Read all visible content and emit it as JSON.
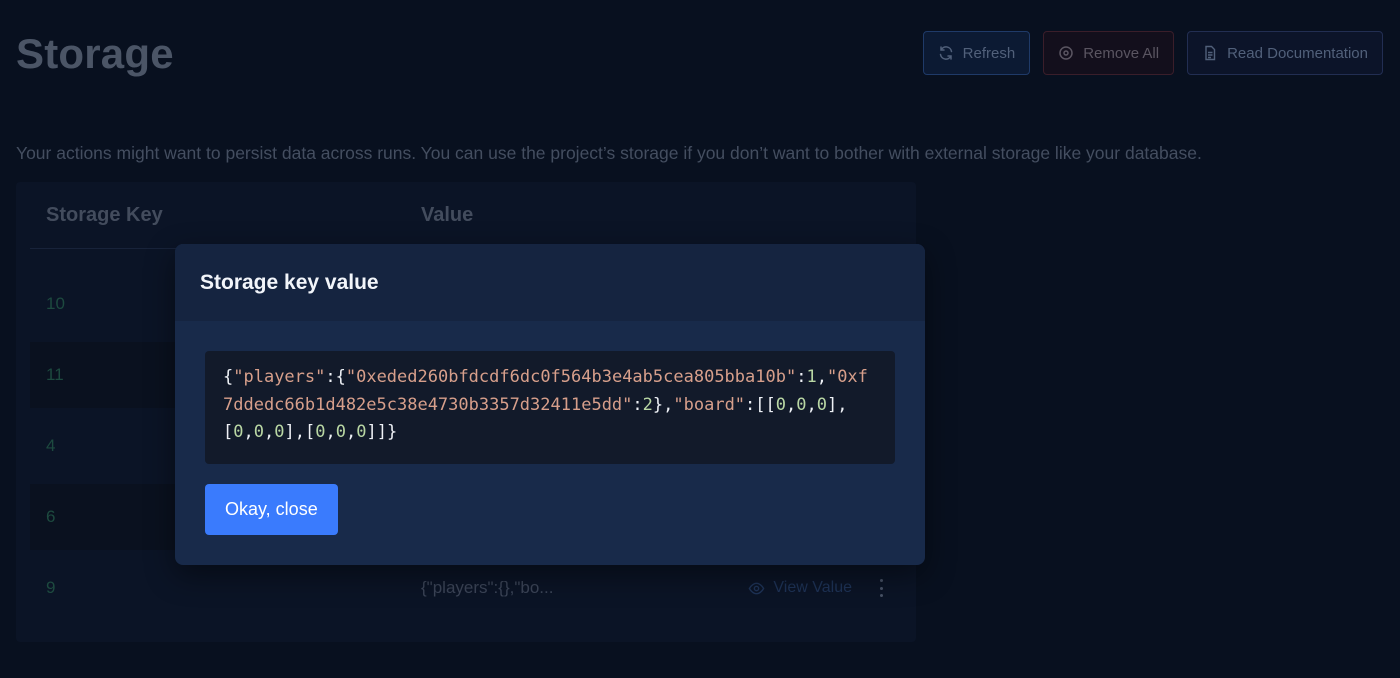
{
  "page": {
    "title": "Storage",
    "description": "Your actions might want to persist data across runs. You can use the project’s storage if you don’t want to bother with external storage like your database."
  },
  "header_actions": {
    "refresh_label": "Refresh",
    "remove_all_label": "Remove All",
    "docs_label": "Read Documentation"
  },
  "table": {
    "columns": [
      "Storage Key",
      "Value"
    ],
    "rows": [
      {
        "key": "10",
        "value": ""
      },
      {
        "key": "11",
        "value": ""
      },
      {
        "key": "4",
        "value": ""
      },
      {
        "key": "6",
        "value": ""
      },
      {
        "key": "9",
        "value": "{\"players\":{},\"bo...",
        "action": "View Value"
      }
    ]
  },
  "modal": {
    "title": "Storage key value",
    "value_tokens": [
      {
        "t": "{",
        "c": "punc"
      },
      {
        "t": "\"players\"",
        "c": "str"
      },
      {
        "t": ":{",
        "c": "punc"
      },
      {
        "t": "\"0xeded260bfdcdf6dc0f564b3e4ab5cea805bba10b\"",
        "c": "str"
      },
      {
        "t": ":",
        "c": "punc"
      },
      {
        "t": "1",
        "c": "num"
      },
      {
        "t": ",",
        "c": "punc"
      },
      {
        "t": "\"0xf7ddedc66b1d482e5c38e4730b3357d32411e5dd\"",
        "c": "str"
      },
      {
        "t": ":",
        "c": "punc"
      },
      {
        "t": "2",
        "c": "num"
      },
      {
        "t": "},",
        "c": "punc"
      },
      {
        "t": "\"board\"",
        "c": "str"
      },
      {
        "t": ":[[",
        "c": "punc"
      },
      {
        "t": "0",
        "c": "num"
      },
      {
        "t": ",",
        "c": "punc"
      },
      {
        "t": "0",
        "c": "num"
      },
      {
        "t": ",",
        "c": "punc"
      },
      {
        "t": "0",
        "c": "num"
      },
      {
        "t": "],[",
        "c": "punc"
      },
      {
        "t": "0",
        "c": "num"
      },
      {
        "t": ",",
        "c": "punc"
      },
      {
        "t": "0",
        "c": "num"
      },
      {
        "t": ",",
        "c": "punc"
      },
      {
        "t": "0",
        "c": "num"
      },
      {
        "t": "],[",
        "c": "punc"
      },
      {
        "t": "0",
        "c": "num"
      },
      {
        "t": ",",
        "c": "punc"
      },
      {
        "t": "0",
        "c": "num"
      },
      {
        "t": ",",
        "c": "punc"
      },
      {
        "t": "0",
        "c": "num"
      },
      {
        "t": "]]}",
        "c": "punc"
      }
    ],
    "close_label": "Okay, close"
  },
  "colors": {
    "primary": "#3a7bfd",
    "modal_bg": "#182a4a",
    "code_bg": "#121a2a",
    "json_string": "#d79f8b",
    "json_number": "#b9d7a4"
  },
  "icons": {
    "refresh": "refresh-icon",
    "remove_all": "remove-circle-icon",
    "docs": "document-icon",
    "view": "eye-icon",
    "more": "more-vertical-icon"
  }
}
